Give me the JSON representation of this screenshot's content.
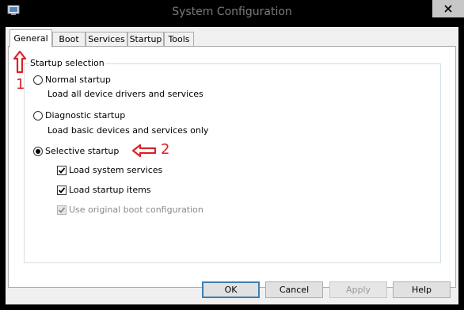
{
  "window": {
    "title": "System Configuration"
  },
  "tabs": [
    {
      "label": "General",
      "active": true
    },
    {
      "label": "Boot",
      "active": false
    },
    {
      "label": "Services",
      "active": false
    },
    {
      "label": "Startup",
      "active": false
    },
    {
      "label": "Tools",
      "active": false
    }
  ],
  "startup_selection": {
    "legend": "Startup selection",
    "normal": {
      "label": "Normal startup",
      "description": "Load all device drivers and services",
      "selected": false
    },
    "diagnostic": {
      "label": "Diagnostic startup",
      "description": "Load basic devices and services only",
      "selected": false
    },
    "selective": {
      "label": "Selective startup",
      "selected": true,
      "options": [
        {
          "label": "Load system services",
          "checked": true,
          "enabled": true
        },
        {
          "label": "Load startup items",
          "checked": true,
          "enabled": true
        },
        {
          "label": "Use original boot configuration",
          "checked": true,
          "enabled": false
        }
      ]
    }
  },
  "buttons": {
    "ok": "OK",
    "cancel": "Cancel",
    "apply": "Apply",
    "help": "Help"
  },
  "annotations": {
    "marker_1": "1",
    "marker_2": "2",
    "color": "#d9222a"
  },
  "icons": {
    "app": "msconfig-icon",
    "close": "close-icon",
    "arrow_up": "arrow-up-icon",
    "arrow_left": "arrow-left-icon"
  }
}
